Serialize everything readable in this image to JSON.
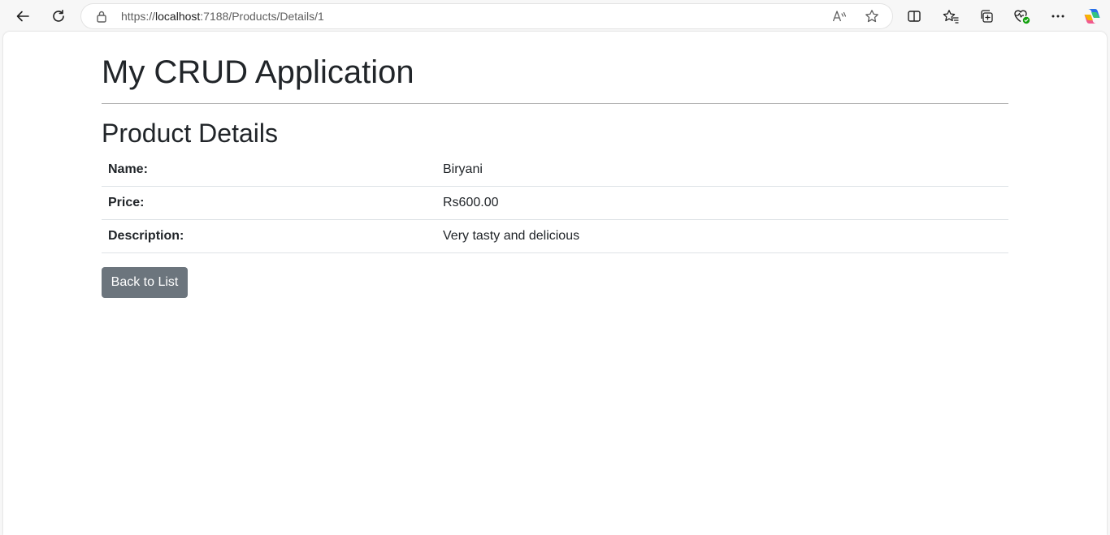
{
  "browser": {
    "url_prefix": "https://",
    "url_host": "localhost",
    "url_path": ":7188/Products/Details/1",
    "icons": {
      "back": "back-arrow-icon",
      "refresh": "refresh-icon",
      "lock": "lock-icon",
      "read_aloud": "read-aloud-icon",
      "favorite": "star-icon",
      "split_screen": "split-screen-icon",
      "favorites": "favorites-icon",
      "collections": "collections-icon",
      "browser_essentials": "heart-pulse-icon",
      "more": "more-icon",
      "copilot": "copilot-icon"
    }
  },
  "page": {
    "app_title": "My CRUD Application",
    "heading": "Product Details",
    "details": [
      {
        "label": "Name:",
        "value": "Biryani"
      },
      {
        "label": "Price:",
        "value": "Rs600.00"
      },
      {
        "label": "Description:",
        "value": "Very tasty and delicious"
      }
    ],
    "back_button": "Back to List"
  },
  "colors": {
    "button_bg": "#6c757d",
    "text": "#212529",
    "divider": "#dee2e6"
  }
}
